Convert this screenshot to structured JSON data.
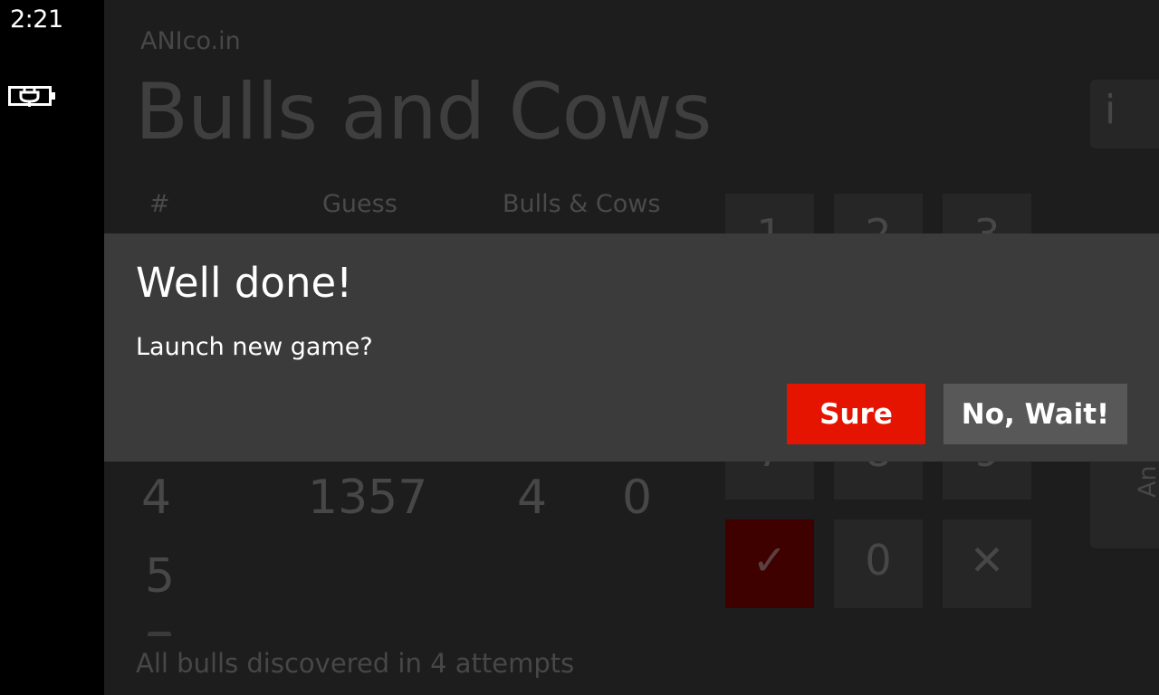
{
  "status_bar": {
    "time": "2:21",
    "battery_icon": "battery-charging-icon"
  },
  "app": {
    "brand": "ANIco.in",
    "title": "Bulls and Cows",
    "info_label": "i",
    "columns": [
      "#",
      "Guess",
      "Bulls & Cows"
    ],
    "rows": [
      {
        "num": "4",
        "guess": "1357",
        "bulls": "4",
        "cows": "0"
      },
      {
        "num": "5",
        "guess": "",
        "bulls": "",
        "cows": ""
      }
    ],
    "keypad": {
      "visible_keys": [
        "1",
        "2",
        "3",
        "7",
        "8",
        "9"
      ],
      "confirm_symbol": "✓",
      "zero": "0",
      "clear_symbol": "✕",
      "confirm_color": "#3f0000"
    },
    "answer_label": "An",
    "status_text": "All bulls discovered in 4 attempts"
  },
  "dialog": {
    "title": "Well done!",
    "message": "Launch new game?",
    "primary_button": "Sure",
    "secondary_button": "No, Wait!",
    "accent": "#e51400"
  }
}
